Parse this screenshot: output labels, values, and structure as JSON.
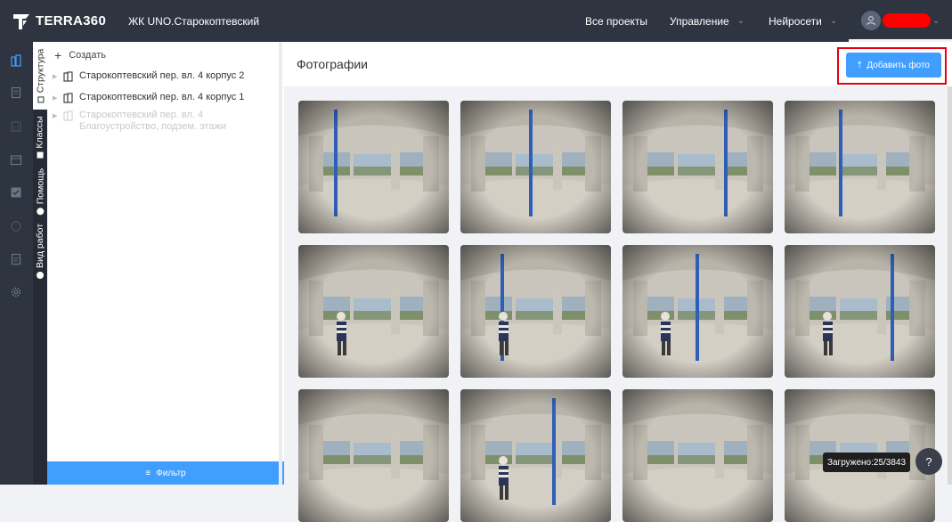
{
  "header": {
    "logo_text": "TERRA360",
    "project_title": "ЖК UNO.Старокоптевский",
    "nav": [
      {
        "label": "Все проекты",
        "has_dropdown": false
      },
      {
        "label": "Управление",
        "has_dropdown": true
      },
      {
        "label": "Нейросети",
        "has_dropdown": true
      }
    ],
    "user_icon": "user-icon",
    "user_name_redacted": true
  },
  "rail": {
    "icons": [
      "buildings-icon",
      "document-icon",
      "chart-icon",
      "calendar-icon",
      "checklist-icon",
      "gauge-icon",
      "report-icon",
      "settings-icon"
    ],
    "active_index": 0
  },
  "vtabs": [
    {
      "label": "Структура",
      "icon": "square-icon",
      "active": true
    },
    {
      "label": "Классы",
      "icon": "flag-icon",
      "active": false
    },
    {
      "label": "Помощь",
      "icon": "help-circle-icon",
      "active": false
    },
    {
      "label": "Вид работ",
      "icon": "help-circle-icon",
      "active": false
    }
  ],
  "tree": {
    "create_label": "Создать",
    "nodes": [
      {
        "label": "Старокоптевский пер. вл. 4 корпус 2",
        "enabled": true
      },
      {
        "label": "Старокоптевский пер. вл. 4 корпус 1",
        "enabled": true
      },
      {
        "label": "Старокоптевский пер. вл. 4 Благоустройство, подзем. этажи",
        "enabled": false
      }
    ],
    "filter_label": "Фильтр"
  },
  "main": {
    "title": "Фотографии",
    "add_photo_label": "Добавить фото"
  },
  "photos": [
    {
      "pole": true,
      "person": false
    },
    {
      "pole": true,
      "person": false
    },
    {
      "pole": true,
      "person": false
    },
    {
      "pole": true,
      "person": false
    },
    {
      "pole": false,
      "person": true
    },
    {
      "pole": true,
      "person": true
    },
    {
      "pole": true,
      "person": true
    },
    {
      "pole": true,
      "person": true
    },
    {
      "pole": false,
      "person": false
    },
    {
      "pole": true,
      "person": true
    },
    {
      "pole": false,
      "person": false
    },
    {
      "pole": false,
      "person": false
    }
  ],
  "status": {
    "uploaded_label": "Загружено:",
    "uploaded_count": "25/3843"
  },
  "colors": {
    "topbar": "#2e3440",
    "accent": "#409eff",
    "highlight": "#e60012",
    "redaction": "#ff0000"
  }
}
